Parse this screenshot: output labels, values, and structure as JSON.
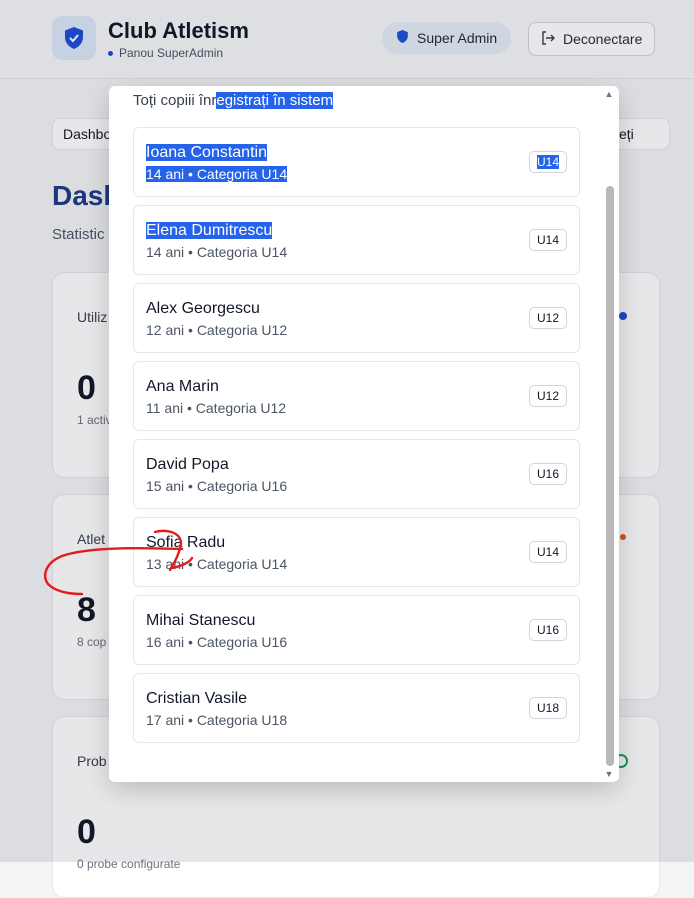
{
  "header": {
    "app_title": "Club Atletism",
    "app_subtitle": "Panou SuperAdmin",
    "role_label": "Super Admin",
    "logout_label": "Deconectare"
  },
  "nav": {
    "tab_first": "Dashboa",
    "tab_last": "eți"
  },
  "page": {
    "title": "Dash",
    "subtitle": "Statistic"
  },
  "stats": [
    {
      "label": "Utiliz",
      "value": "0",
      "note": "1 activ"
    },
    {
      "label": "Atlet",
      "value": "8",
      "note": "8 cop"
    },
    {
      "label": "Prob",
      "value": "0",
      "note": "0 probe configurate"
    }
  ],
  "modal": {
    "subtitle_plain": "Toți copiii înr",
    "subtitle_selected": "egistrați în sistem",
    "children": [
      {
        "name": "Ioana Constantin",
        "meta": "14 ani • Categoria U14",
        "badge": "U14",
        "selected": true
      },
      {
        "name": "Elena Dumitrescu",
        "meta": "14 ani • Categoria U14",
        "badge": "U14",
        "selected": false
      },
      {
        "name": "Alex Georgescu",
        "meta": "12 ani • Categoria U12",
        "badge": "U12",
        "selected": false
      },
      {
        "name": "Ana Marin",
        "meta": "11 ani • Categoria U12",
        "badge": "U12",
        "selected": false
      },
      {
        "name": "David Popa",
        "meta": "15 ani • Categoria U16",
        "badge": "U16",
        "selected": false
      },
      {
        "name": "Sofia Radu",
        "meta": "13 ani • Categoria U14",
        "badge": "U14",
        "selected": false
      },
      {
        "name": "Mihai Stanescu",
        "meta": "16 ani • Categoria U16",
        "badge": "U16",
        "selected": false
      },
      {
        "name": "Cristian Vasile",
        "meta": "17 ani • Categoria U18",
        "badge": "U18",
        "selected": false
      }
    ]
  },
  "colors": {
    "accent": "#1d4ed8",
    "selection": "#2563eb",
    "annotation": "#e11d1d"
  },
  "icons": {
    "logo": "shield-icon",
    "role": "shield-icon",
    "logout": "logout-icon"
  }
}
